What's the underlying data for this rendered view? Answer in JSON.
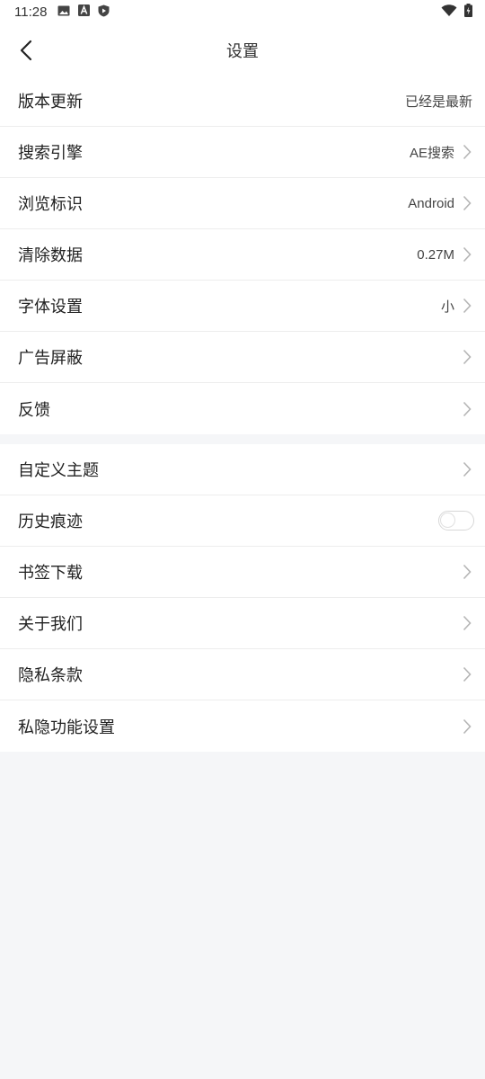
{
  "status_bar": {
    "time": "11:28",
    "icons_left": [
      "image-icon",
      "font-a-icon",
      "shield-play-icon"
    ],
    "icons_right": [
      "wifi-icon",
      "battery-icon"
    ]
  },
  "header": {
    "title": "设置",
    "back_icon": "chevron-left-icon"
  },
  "section1": [
    {
      "label": "版本更新",
      "value": "已经是最新",
      "chevron": false
    },
    {
      "label": "搜索引擎",
      "value": "AE搜索",
      "chevron": true
    },
    {
      "label": "浏览标识",
      "value": "Android",
      "chevron": true
    },
    {
      "label": "清除数据",
      "value": "0.27M",
      "chevron": true
    },
    {
      "label": "字体设置",
      "value": "小",
      "chevron": true
    },
    {
      "label": "广告屏蔽",
      "value": "",
      "chevron": true
    },
    {
      "label": "反馈",
      "value": "",
      "chevron": true
    }
  ],
  "section2": [
    {
      "label": "自定义主题",
      "chevron": true
    },
    {
      "label": "历史痕迹",
      "toggle": false
    },
    {
      "label": "书签下载",
      "chevron": true
    },
    {
      "label": "关于我们",
      "chevron": true
    },
    {
      "label": "隐私条款",
      "chevron": true
    },
    {
      "label": "私隐功能设置",
      "chevron": true
    }
  ],
  "colors": {
    "background": "#f5f6f8",
    "surface": "#ffffff",
    "text": "#222222",
    "divider": "#ededed",
    "chevron": "#b5b5b5"
  }
}
